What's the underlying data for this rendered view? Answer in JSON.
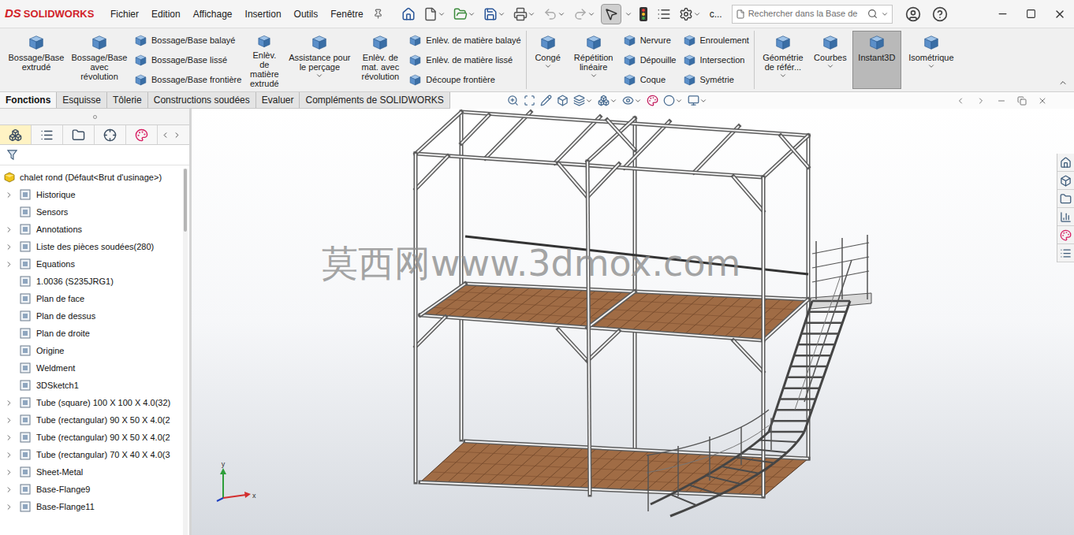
{
  "app": {
    "logo_mark": "DS",
    "logo": "SOLIDWORKS"
  },
  "menus": [
    "Fichier",
    "Edition",
    "Affichage",
    "Insertion",
    "Outils",
    "Fenêtre"
  ],
  "toolbar": {
    "select_active": true,
    "label": "c..."
  },
  "search": {
    "placeholder": "Rechercher dans la Base de"
  },
  "ribbon": {
    "sections": [
      [
        {
          "kind": "large",
          "label": "Bossage/Base extrudé",
          "dropdown": false,
          "selected": false
        },
        {
          "kind": "large",
          "label": "Bossage/Base avec révolution",
          "dropdown": false,
          "selected": false
        },
        {
          "kind": "stack",
          "items": [
            "Bossage/Base balayé",
            "Bossage/Base lissé",
            "Bossage/Base frontière"
          ]
        },
        {
          "kind": "large",
          "label": "Enlèv. de matière extrudé",
          "dropdown": false,
          "selected": false
        },
        {
          "kind": "large",
          "label": "Assistance pour le perçage",
          "dropdown": true,
          "selected": false
        },
        {
          "kind": "large",
          "label": "Enlèv. de mat. avec révolution",
          "dropdown": false,
          "selected": false
        },
        {
          "kind": "stack",
          "items": [
            "Enlèv. de matière balayé",
            "Enlèv. de matière lissé",
            "Découpe frontière"
          ]
        }
      ],
      [
        {
          "kind": "large",
          "label": "Congé",
          "dropdown": true,
          "selected": false
        },
        {
          "kind": "large",
          "label": "Répétition linéaire",
          "dropdown": true,
          "selected": false
        },
        {
          "kind": "stack",
          "items": [
            "Nervure",
            "Dépouille",
            "Coque"
          ]
        },
        {
          "kind": "stack",
          "items": [
            "Enroulement",
            "Intersection",
            "Symétrie"
          ]
        }
      ],
      [
        {
          "kind": "large",
          "label": "Géométrie de référ...",
          "dropdown": true,
          "selected": false
        },
        {
          "kind": "large",
          "label": "Courbes",
          "dropdown": true,
          "selected": false
        },
        {
          "kind": "large",
          "label": "Instant3D",
          "dropdown": false,
          "selected": true
        },
        {
          "kind": "large",
          "label": "Isométrique",
          "dropdown": true,
          "selected": false
        }
      ]
    ]
  },
  "tabs": [
    {
      "label": "Fonctions",
      "selected": true
    },
    {
      "label": "Esquisse",
      "selected": false
    },
    {
      "label": "Tôlerie",
      "selected": false
    },
    {
      "label": "Constructions soudées",
      "selected": false
    },
    {
      "label": "Evaluer",
      "selected": false
    },
    {
      "label": "Compléments de SOLIDWORKS",
      "selected": false
    }
  ],
  "panel_tabs": [
    {
      "selected": true
    },
    {
      "selected": false
    },
    {
      "selected": false
    },
    {
      "selected": false
    },
    {
      "selected": false
    }
  ],
  "feature_tree": {
    "root": "chalet rond (Défaut<Brut d'usinage>)",
    "items": [
      {
        "label": "Historique",
        "expandable": true
      },
      {
        "label": "Sensors",
        "expandable": false
      },
      {
        "label": "Annotations",
        "expandable": true
      },
      {
        "label": "Liste des pièces soudées(280)",
        "expandable": true
      },
      {
        "label": "Equations",
        "expandable": true
      },
      {
        "label": "1.0036 (S235JRG1)",
        "expandable": false
      },
      {
        "label": "Plan de face",
        "expandable": false
      },
      {
        "label": "Plan de dessus",
        "expandable": false
      },
      {
        "label": "Plan de droite",
        "expandable": false
      },
      {
        "label": "Origine",
        "expandable": false
      },
      {
        "label": "Weldment",
        "expandable": false
      },
      {
        "label": "3DSketch1",
        "expandable": false
      },
      {
        "label": "Tube (square) 100 X 100 X 4.0(32)",
        "expandable": true
      },
      {
        "label": "Tube (rectangular) 90 X 50 X 4.0(2",
        "expandable": true
      },
      {
        "label": "Tube (rectangular) 90 X 50 X 4.0(2",
        "expandable": true
      },
      {
        "label": "Tube (rectangular) 70 X 40 X 4.0(3",
        "expandable": true
      },
      {
        "label": "Sheet-Metal",
        "expandable": true
      },
      {
        "label": "Base-Flange9",
        "expandable": true
      },
      {
        "label": "Base-Flange11",
        "expandable": true
      }
    ]
  },
  "viewport": {
    "watermark": "莫西网www.3dmox.com",
    "triad": {
      "x": "x",
      "y": "y"
    }
  }
}
